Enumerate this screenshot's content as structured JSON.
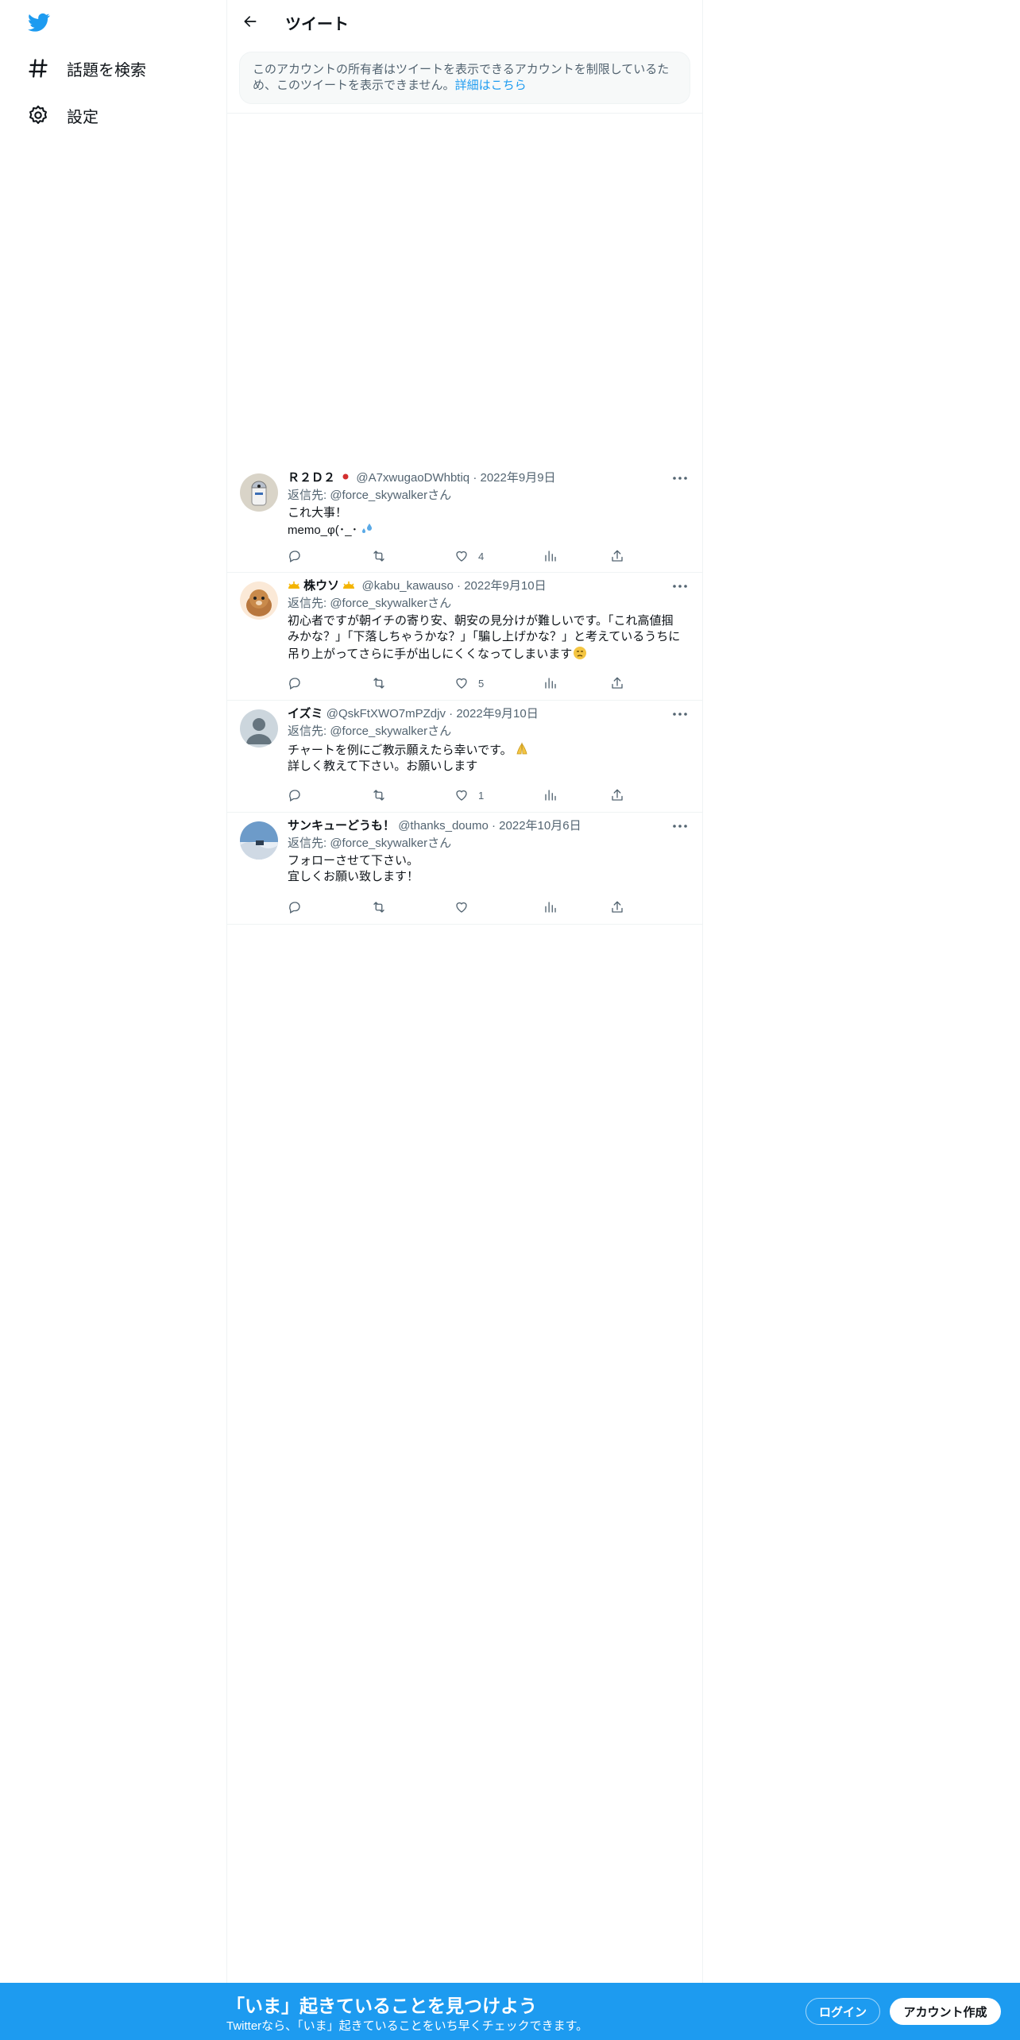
{
  "sidebar": {
    "items": [
      {
        "label": "話題を検索",
        "icon": "hashtag-icon"
      },
      {
        "label": "設定",
        "icon": "gear-icon"
      }
    ]
  },
  "header": {
    "title": "ツイート"
  },
  "notice": {
    "text": "このアカウントの所有者はツイートを表示できるアカウントを制限しているため、このツイートを表示できません。",
    "link": "詳細はこちら"
  },
  "tweets": [
    {
      "name": "Ｒ２Ｄ２",
      "handle": "@A7xwugaoDWhbtiq",
      "dot": "·",
      "date": "2022年9月9日",
      "reply_to": "返信先: @force_skywalkerさん",
      "lines": [
        "これ大事！",
        "memo_φ(･_･"
      ],
      "likes": "4"
    },
    {
      "name": "株ウソ",
      "handle": "@kabu_kawauso",
      "dot": "·",
      "date": "2022年9月10日",
      "reply_to": "返信先: @force_skywalkerさん",
      "lines": [
        "初心者ですが朝イチの寄り安、朝安の見分けが難しいです。「これ高値掴みかな？」「下落しちゃうかな？」「騙し上げかな？」と考えているうちに吊り上がってさらに手が出しにくくなってしまいます"
      ],
      "likes": "5"
    },
    {
      "name": "イズミ",
      "handle": "@QskFtXWO7mPZdjv",
      "dot": "·",
      "date": "2022年9月10日",
      "reply_to": "返信先: @force_skywalkerさん",
      "lines": [
        "チャートを例にご教示願えたら幸いです。",
        "詳しく教えて下さい。お願いします"
      ],
      "likes": "1"
    },
    {
      "name": "サンキューどうも！",
      "handle": "@thanks_doumo",
      "dot": "·",
      "date": "2022年10月6日",
      "reply_to": "返信先: @force_skywalkerさん",
      "lines": [
        "フォローさせて下さい。",
        "宜しくお願い致します！"
      ],
      "likes": ""
    }
  ],
  "bottom_bar": {
    "title": "「いま」起きていることを見つけよう",
    "subtitle": "Twitterなら、「いま」起きていることをいち早くチェックできます。",
    "login": "ログイン",
    "signup": "アカウント作成"
  },
  "colors": {
    "accent": "#1d9bf0",
    "text": "#0f1419",
    "muted": "#536471",
    "border": "#eff3f4"
  }
}
